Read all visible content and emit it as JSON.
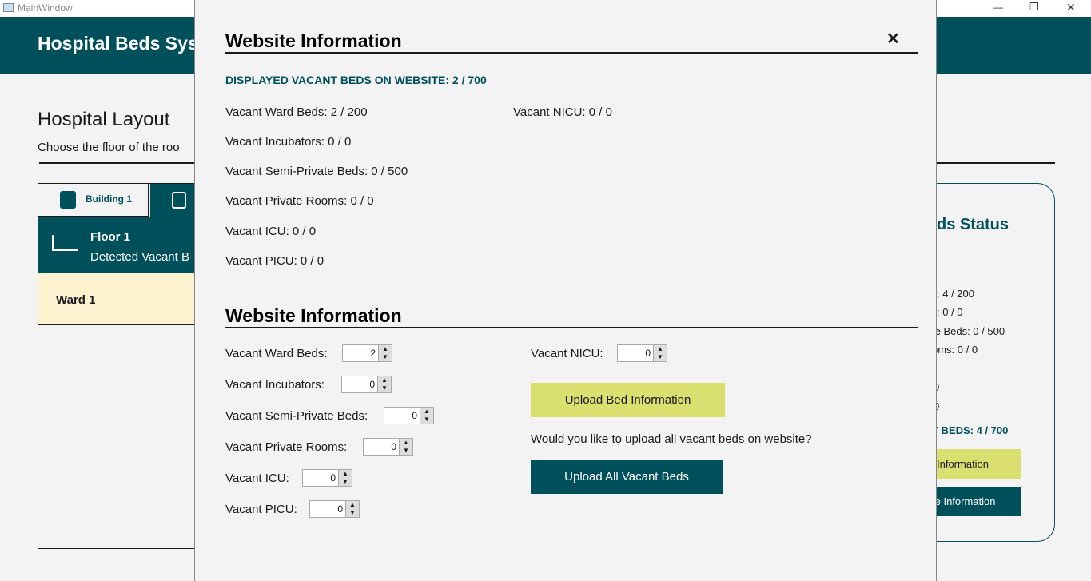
{
  "window": {
    "title": "MainWindow",
    "minimize": "—",
    "restore": "❐",
    "close": "✕"
  },
  "app": {
    "title": "Hospital Beds Sys"
  },
  "layout": {
    "heading": "Hospital Layout",
    "subtitle": "Choose the floor of the roo",
    "tabs": [
      {
        "label": "Building 1"
      },
      {
        "label": ""
      }
    ],
    "floor": {
      "name": "Floor 1",
      "detail": "Detected Vacant B"
    },
    "wards": [
      {
        "label": "Ward 1"
      }
    ]
  },
  "status_panel": {
    "title": "ds Status",
    "rows": [
      ":  4 / 200",
      ":  0 / 0",
      "te Beds:  0 / 500",
      "oms:  0 / 0",
      "0",
      "0"
    ],
    "total": "T BEDS:  4 / 700",
    "btn1": "Information",
    "btn2": "te Information"
  },
  "modal": {
    "title": "Website Information",
    "close": "✕",
    "displayed": "DISPLAYED VACANT BEDS ON WEBSITE:  2 / 700",
    "left": [
      "Vacant Ward Beds:  2 / 200",
      "Vacant Incubators:  0 / 0",
      "Vacant Semi-Private Beds:  0 / 500",
      "Vacant Private Rooms:  0 / 0",
      "Vacant ICU:  0 / 0",
      "Vacant PICU:  0 / 0"
    ],
    "right": [
      "Vacant NICU:  0 / 0"
    ],
    "form_title": "Website Information",
    "fields": [
      {
        "label": "Vacant Ward Beds:",
        "value": "2"
      },
      {
        "label": "Vacant Incubators:",
        "value": "0"
      },
      {
        "label": "Vacant Semi-Private Beds:",
        "value": "0"
      },
      {
        "label": "Vacant Private Rooms:",
        "value": "0"
      },
      {
        "label": "Vacant ICU:",
        "value": "0"
      },
      {
        "label": "Vacant PICU:",
        "value": "0"
      }
    ],
    "nicu": {
      "label": "Vacant NICU:",
      "value": "0"
    },
    "upload_btn": "Upload Bed Information",
    "question": "Would you like to upload all vacant beds on website?",
    "upload_all_btn": "Upload All Vacant Beds"
  },
  "colors": {
    "teal": "#00505c",
    "yellow": "#d9e070",
    "ward": "#fdf2d0"
  }
}
